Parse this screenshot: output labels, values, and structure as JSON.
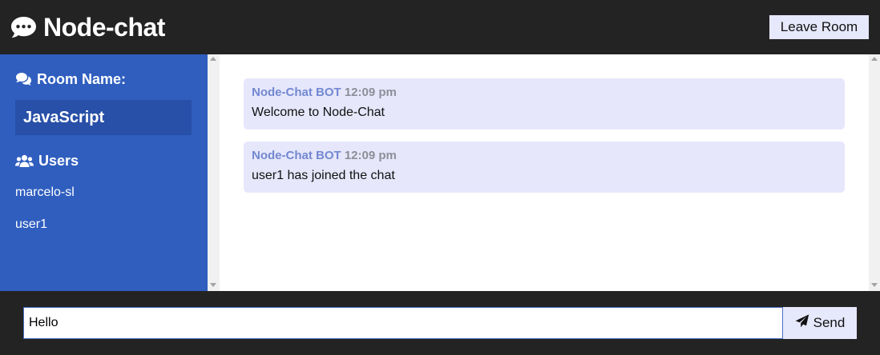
{
  "header": {
    "title": "Node-chat",
    "logo_icon": "comment-dots-icon",
    "leave_label": "Leave Room"
  },
  "sidebar": {
    "room_heading": "Room Name:",
    "room_name": "JavaScript",
    "users_heading": "Users",
    "users": [
      "marcelo-sl",
      "user1"
    ]
  },
  "messages": [
    {
      "author": "Node-Chat BOT",
      "time": "12:09 pm",
      "text": "Welcome to Node-Chat"
    },
    {
      "author": "Node-Chat BOT",
      "time": "12:09 pm",
      "text": "user1 has joined the chat"
    }
  ],
  "composer": {
    "value": "Hello",
    "send_label": "Send",
    "send_icon": "paper-plane-icon"
  },
  "colors": {
    "header_bg": "#232323",
    "sidebar_bg": "#2f5ebf",
    "room_box_bg": "#2850a8",
    "message_bg": "#e6e7fb",
    "author_color": "#7388d1"
  }
}
